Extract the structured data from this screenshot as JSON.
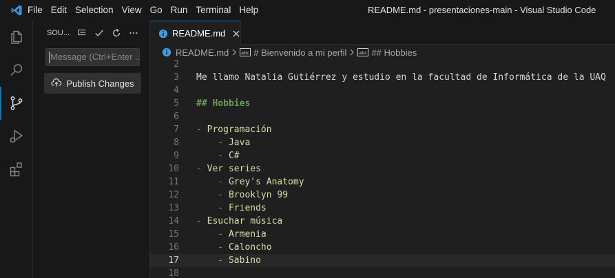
{
  "app": {
    "title": "README.md - presentaciones-main - Visual Studio Code"
  },
  "menu": [
    "File",
    "Edit",
    "Selection",
    "View",
    "Go",
    "Run",
    "Terminal",
    "Help"
  ],
  "sidebar": {
    "title": "SOU...",
    "commit_placeholder": "Message (Ctrl+Enter ...",
    "publish_label": "Publish Changes"
  },
  "tab": {
    "label": "README.md"
  },
  "breadcrumbs": {
    "file": "README.md",
    "section1": "# Bienvenido a mi perfil",
    "section2": "## Hobbies"
  },
  "code": {
    "lines": [
      {
        "n": "2",
        "text": ""
      },
      {
        "n": "3",
        "text": "Me llamo Natalia Gutiérrez y estudio en la facultad de Informática de la UAQ"
      },
      {
        "n": "4",
        "text": ""
      },
      {
        "n": "5",
        "text": "## Hobbies"
      },
      {
        "n": "6",
        "text": ""
      },
      {
        "n": "7",
        "text": "- Programación"
      },
      {
        "n": "8",
        "text": "    - Java"
      },
      {
        "n": "9",
        "text": "    - C#"
      },
      {
        "n": "10",
        "text": "- Ver series"
      },
      {
        "n": "11",
        "text": "    - Grey's Anatomy"
      },
      {
        "n": "12",
        "text": "    - Brooklyn 99"
      },
      {
        "n": "13",
        "text": "    - Friends"
      },
      {
        "n": "14",
        "text": "- Esuchar música"
      },
      {
        "n": "15",
        "text": "    - Armenia"
      },
      {
        "n": "16",
        "text": "    - Caloncho"
      },
      {
        "n": "17",
        "text": "    - Sabino"
      },
      {
        "n": "18",
        "text": ""
      }
    ],
    "current_line": "17"
  },
  "colors": {
    "accent": "#0078d4",
    "heading": "#6a9955",
    "list_marker": "#6796e6",
    "list_text": "#dcdcaa"
  }
}
